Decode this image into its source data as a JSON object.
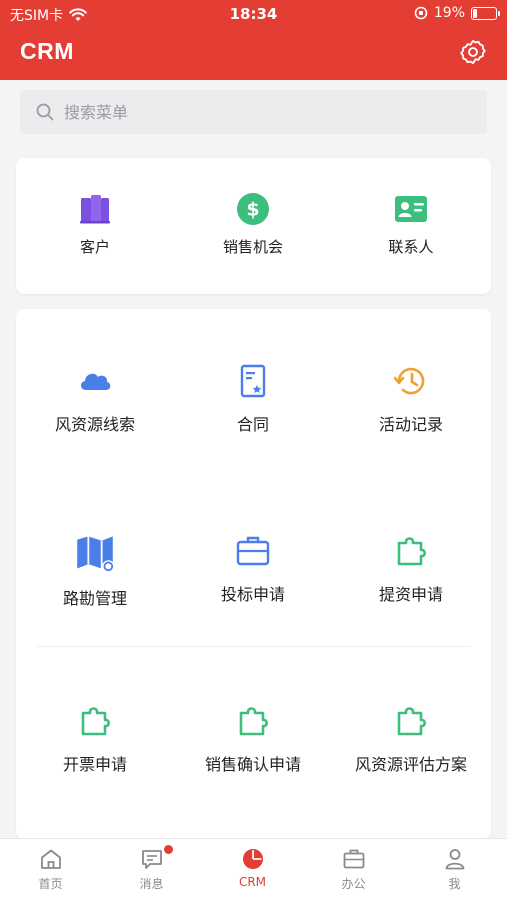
{
  "status_bar": {
    "carrier": "无SIM卡",
    "time": "18:34",
    "battery": "19%",
    "battery_level": 0.19
  },
  "header": {
    "title": "CRM"
  },
  "search": {
    "placeholder": "搜索菜单"
  },
  "card1": {
    "items": [
      {
        "label": "客户",
        "icon": "building-icon",
        "color": "#7b4fe0"
      },
      {
        "label": "销售机会",
        "icon": "dollar-icon",
        "color": "#3cbf7d"
      },
      {
        "label": "联系人",
        "icon": "contact-card-icon",
        "color": "#3cbf7d"
      }
    ]
  },
  "card2": {
    "items": [
      {
        "label": "风资源线索",
        "icon": "cloud-icon",
        "color": "#4a7ee8"
      },
      {
        "label": "合同",
        "icon": "contract-icon",
        "color": "#4a7ee8"
      },
      {
        "label": "活动记录",
        "icon": "history-clock-icon",
        "color": "#f0a030"
      },
      {
        "label": "路勘管理",
        "icon": "map-icon",
        "color": "#4a7ee8"
      },
      {
        "label": "投标申请",
        "icon": "briefcase-icon",
        "color": "#4a7ee8"
      },
      {
        "label": "提资申请",
        "icon": "puzzle-icon",
        "color": "#3cbf7d"
      },
      {
        "label": "开票申请",
        "icon": "puzzle-icon",
        "color": "#3cbf7d"
      },
      {
        "label": "销售确认申请",
        "icon": "puzzle-icon",
        "color": "#3cbf7d"
      },
      {
        "label": "风资源评估方案",
        "icon": "puzzle-icon",
        "color": "#3cbf7d"
      }
    ]
  },
  "tabbar": {
    "tabs": [
      {
        "label": "首页",
        "icon": "home-icon"
      },
      {
        "label": "消息",
        "icon": "message-icon",
        "badge": true
      },
      {
        "label": "CRM",
        "icon": "pie-chart-icon",
        "active": true
      },
      {
        "label": "办公",
        "icon": "briefcase-icon"
      },
      {
        "label": "我",
        "icon": "person-icon"
      }
    ]
  },
  "colors": {
    "brand": "#e43d33",
    "green": "#3cbf7d",
    "blue": "#4a7ee8",
    "orange": "#f0a030",
    "purple": "#7b4fe0"
  }
}
